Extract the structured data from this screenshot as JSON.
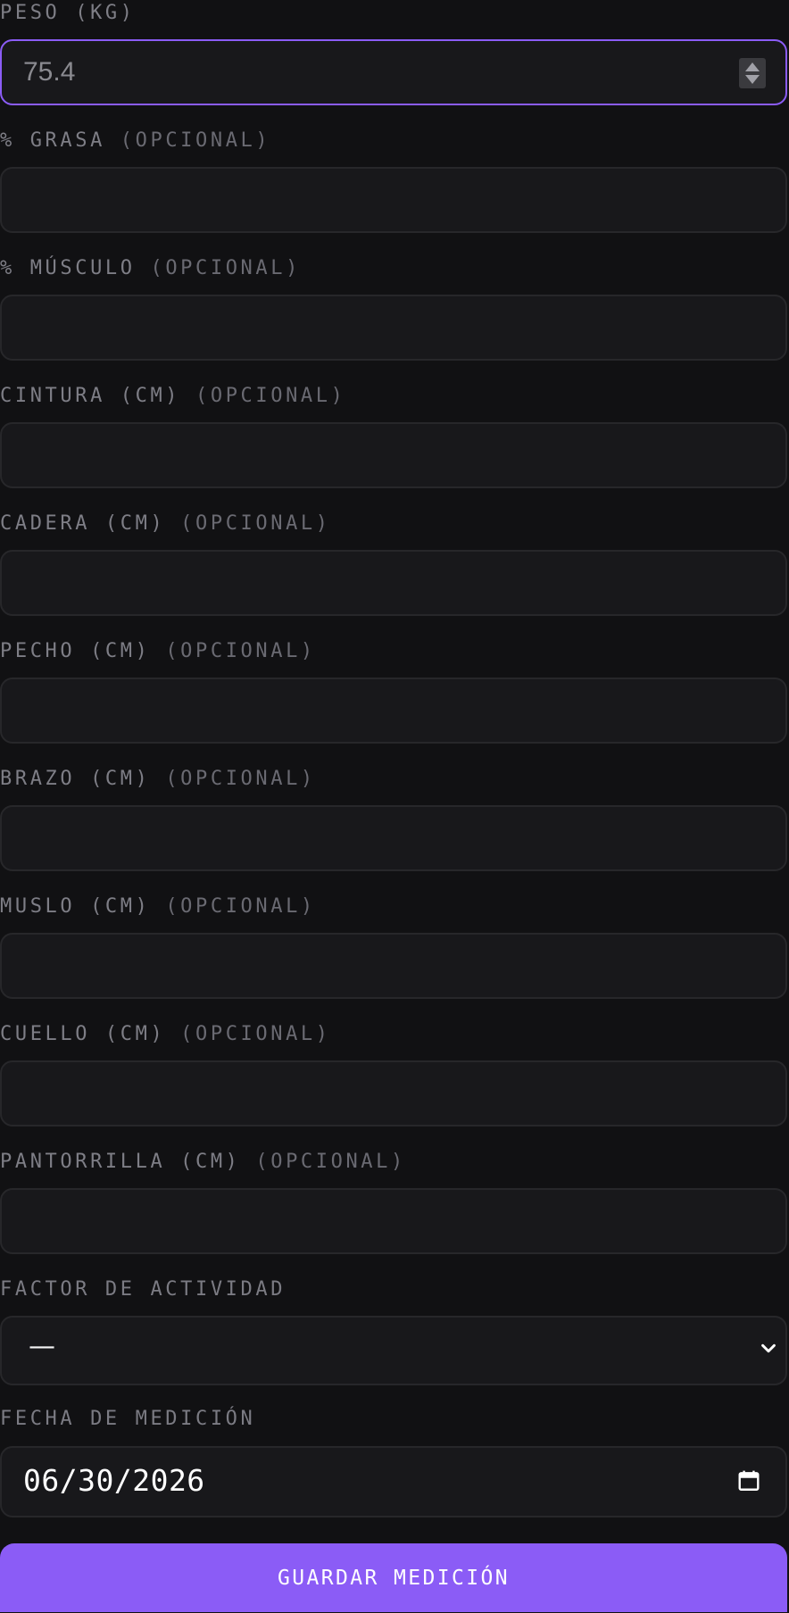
{
  "form": {
    "weight": {
      "label": "PESO (KG)",
      "value": "75.4"
    },
    "optional_fields": [
      {
        "label": "% GRASA",
        "suffix": "(OPCIONAL)",
        "value": ""
      },
      {
        "label": "% MÚSCULO",
        "suffix": "(OPCIONAL)",
        "value": ""
      },
      {
        "label": "CINTURA (CM)",
        "suffix": "(OPCIONAL)",
        "value": ""
      },
      {
        "label": "CADERA (CM)",
        "suffix": "(OPCIONAL)",
        "value": ""
      },
      {
        "label": "PECHO (CM)",
        "suffix": "(OPCIONAL)",
        "value": ""
      },
      {
        "label": "BRAZO (CM)",
        "suffix": "(OPCIONAL)",
        "value": ""
      },
      {
        "label": "MUSLO (CM)",
        "suffix": "(OPCIONAL)",
        "value": ""
      },
      {
        "label": "CUELLO (CM)",
        "suffix": "(OPCIONAL)",
        "value": ""
      },
      {
        "label": "PANTORRILLA (CM)",
        "suffix": "(OPCIONAL)",
        "value": ""
      }
    ],
    "activity": {
      "label": "FACTOR DE ACTIVIDAD",
      "selected": "—"
    },
    "date": {
      "label": "FECHA DE MEDICIÓN",
      "value": "06/30/2026"
    },
    "submit_label": "GUARDAR MEDICIÓN"
  },
  "colors": {
    "background": "#111113",
    "field_background": "#18181b",
    "field_border": "#27272a",
    "accent": "#8b5cf6",
    "label": "#7b7b83"
  },
  "icons": {
    "spinner": "number-spinner-icon",
    "select": "chevron-down-icon",
    "date": "calendar-icon"
  }
}
